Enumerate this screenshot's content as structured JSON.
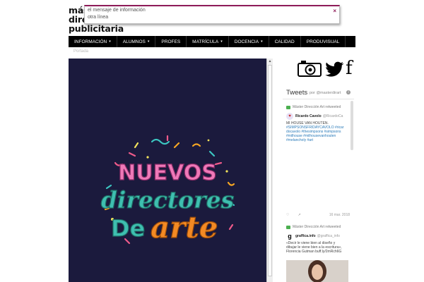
{
  "logo": {
    "line1": "más",
    "line2": "dire",
    "line3": "publicitaria"
  },
  "notification": {
    "line1": "el mensaje de información",
    "line2": "otra línea",
    "close": "×"
  },
  "nav": {
    "items": [
      {
        "label": "INFORMACIÓN",
        "dropdown": true
      },
      {
        "label": "ALUMNOS",
        "dropdown": true
      },
      {
        "label": "PROFES",
        "dropdown": false
      },
      {
        "label": "MATRÍCULA",
        "dropdown": true
      },
      {
        "label": "DOCENCIA",
        "dropdown": true
      },
      {
        "label": "CALIDAD",
        "dropdown": false
      },
      {
        "label": "PRODUVISUAL",
        "dropdown": false
      }
    ],
    "caret": "▾"
  },
  "breadcrumb": "Portada",
  "hero": {
    "line1": "NUEVOS",
    "line2": "directores",
    "line3_left": "De",
    "line3_right": "arte",
    "background": "#1b1a3d"
  },
  "social": {
    "icons": [
      "camera-icon",
      "twitter-icon",
      "facebook-icon"
    ],
    "facebook_glyph": "f"
  },
  "tweets": {
    "title": "Tweets",
    "by": "por @masterdirart",
    "info": "i",
    "items": [
      {
        "retweet": "Máster Dirección Art retweeted",
        "name": "Ricardo Cavolo",
        "handle": "@RicardoCa",
        "avatar": "♥",
        "lines": [
          "MI HOUSE VAN HOUTEN.",
          "#SIMPSONSFRIDAYCAVOLO #ricar",
          "docavolo #thesimpsons #simpsons",
          "#milhouse #milhousevanhouten",
          "#melancholy #art"
        ],
        "date": "16 mar. 2018"
      },
      {
        "retweet": "Máster Dirección Art retweeted",
        "name": "graffica.info",
        "handle": "@graffica_info",
        "avatar": "g",
        "lines": [
          "«Decir le viene bien al diseño y",
          "dibujar le viene bien a la escritura»,",
          "Florencia Gutman buff.ly/2mRch6G"
        ]
      }
    ]
  },
  "colors": {
    "accent": "#8e1b58",
    "nav_bg": "#000000",
    "link": "#2b7bb9"
  }
}
